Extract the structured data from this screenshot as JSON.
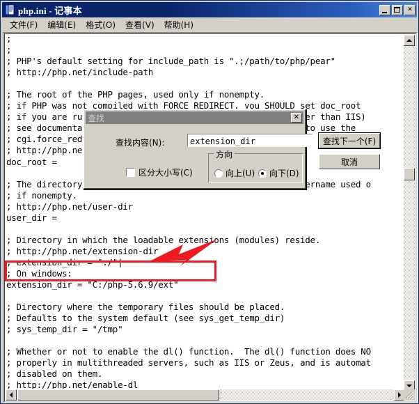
{
  "window": {
    "title": "php.ini - 记事本",
    "icon": "notepad-icon",
    "buttons": {
      "minimize": "_",
      "maximize": "□",
      "close": "✕"
    }
  },
  "menu": {
    "items": [
      {
        "label": "文件(F)",
        "name": "menu-file"
      },
      {
        "label": "编辑(E)",
        "name": "menu-edit"
      },
      {
        "label": "格式(O)",
        "name": "menu-format"
      },
      {
        "label": "查看(V)",
        "name": "menu-view"
      },
      {
        "label": "帮助(H)",
        "name": "menu-help"
      }
    ]
  },
  "editor": {
    "lines": [
      ";",
      ";",
      "; PHP's default setting for include_path is \".;/path/to/php/pear\"",
      "; http://php.net/include-path",
      "",
      "; The root of the PHP pages, used only if nonempty.",
      "; if PHP was not compiled with FORCE_REDIRECT, you SHOULD set doc_root",
      "; if you are running php as a CGI under any web server (other than IIS)",
      "; see documentation for security issues.  The alternate is to use the",
      "; cgi.force_redirect configuration below",
      "; http://php.net/doc-root",
      "doc_root =",
      "",
      "; The directory under which PHP opens the script using /~username used o",
      "; if nonempty.",
      "; http://php.net/user-dir",
      "user_dir =",
      "",
      "; Directory in which the loadable extensions (modules) reside.",
      "; http://php.net/extension-dir",
      "; extension_dir = \"./\"|",
      "; On windows:",
      "extension_dir = \"C:/php-5.6.9/ext\"",
      "",
      "; Directory where the temporary files should be placed.",
      "; Defaults to the system default (see sys_get_temp_dir)",
      "; sys_temp_dir = \"/tmp\"",
      "",
      "; Whether or not to enable the dl() function.  The dl() function does NO",
      "; properly in multithreaded servers, such as IIS or Zeus, and is automat",
      "; disabled on them.",
      "; http://php.net/enable-dl"
    ],
    "highlighted_line": "extension_dir = \"C:/php-5.6.9/ext\"",
    "annotation_color": "#ee1c21"
  },
  "find_dialog": {
    "title": "查找",
    "close_label": "✕",
    "search_label": "查找内容(N):",
    "search_value": "extension_dir",
    "search_placeholder": "",
    "find_next_label": "查找下一个(F)",
    "cancel_label": "取消",
    "match_case_label": "区分大小写(C)",
    "match_case_checked": false,
    "direction": {
      "legend": "方向",
      "up_label": "向上(U)",
      "down_label": "向下(D)",
      "selected": "down"
    }
  },
  "scrollbars": {
    "vertical": {
      "up_arrow": "▲",
      "down_arrow": "▼"
    },
    "horizontal": {
      "left_arrow": "◀",
      "right_arrow": "▶"
    }
  },
  "colors": {
    "titlebar_start": "#0a246a",
    "titlebar_end": "#4f8ade",
    "face": "#d4d0c8",
    "annotation": "#ee1c21",
    "dialog_title": "#808080"
  }
}
